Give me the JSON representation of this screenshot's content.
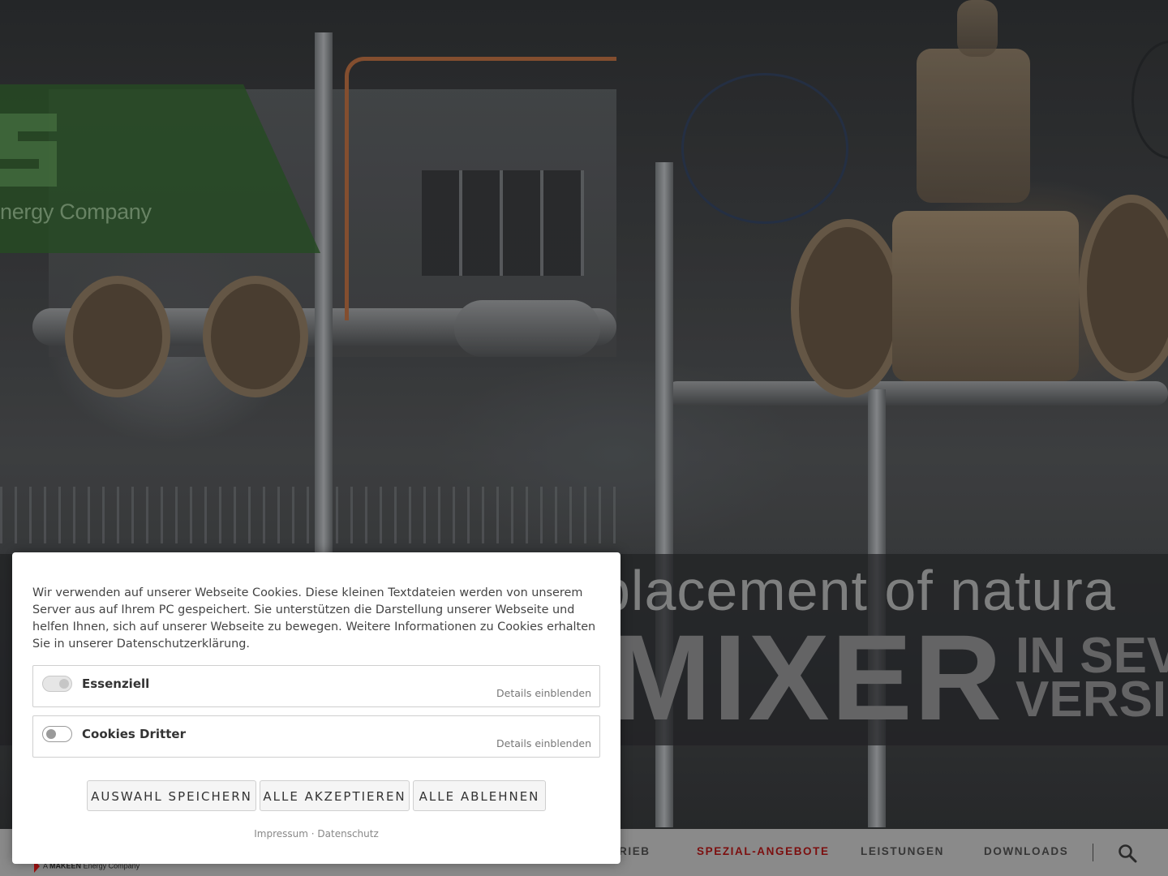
{
  "hero": {
    "logo_fragment_text": "nergy Company",
    "slogan_line1": "placement of natura",
    "slogan_main": "MIXER",
    "slogan_side_line1": "IN SEV",
    "slogan_side_line2": "VERSI"
  },
  "navbar": {
    "brand_small_prefix": "A",
    "brand_small_brand": "MAKEEN",
    "brand_small_suffix": "Energy Company",
    "items": [
      {
        "label": "RIEB",
        "active": false
      },
      {
        "label": "SPEZIAL-ANGEBOTE",
        "active": true
      },
      {
        "label": "LEISTUNGEN",
        "active": false
      },
      {
        "label": "DOWNLOADS",
        "active": false
      }
    ],
    "search_icon": "search-icon"
  },
  "cookie_dialog": {
    "intro": "Wir verwenden auf unserer Webseite Cookies. Diese kleinen Textdateien werden von unserem Server aus auf Ihrem PC gespeichert. Sie unterstützen die Darstellung unserer Webseite und helfen Ihnen, sich auf unserer Webseite zu bewegen. Weitere Informationen zu Cookies erhalten Sie in unserer Datenschutzerklärung.",
    "options": [
      {
        "label": "Essenziell",
        "details": "Details einblenden",
        "enabled": true,
        "locked": true
      },
      {
        "label": "Cookies Dritter",
        "details": "Details einblenden",
        "enabled": false,
        "locked": false
      }
    ],
    "buttons": {
      "save": "AUSWAHL SPEICHERN",
      "accept_all": "ALLE AKZEPTIEREN",
      "reject_all": "ALLE ABLEHNEN"
    },
    "footer": {
      "imprint": "Impressum",
      "separator": "·",
      "privacy": "Datenschutz"
    }
  },
  "colors": {
    "nav_active": "#7c0f0f",
    "nav_bar": "#8a8a8a",
    "logo_green": "#2f5a2c"
  }
}
